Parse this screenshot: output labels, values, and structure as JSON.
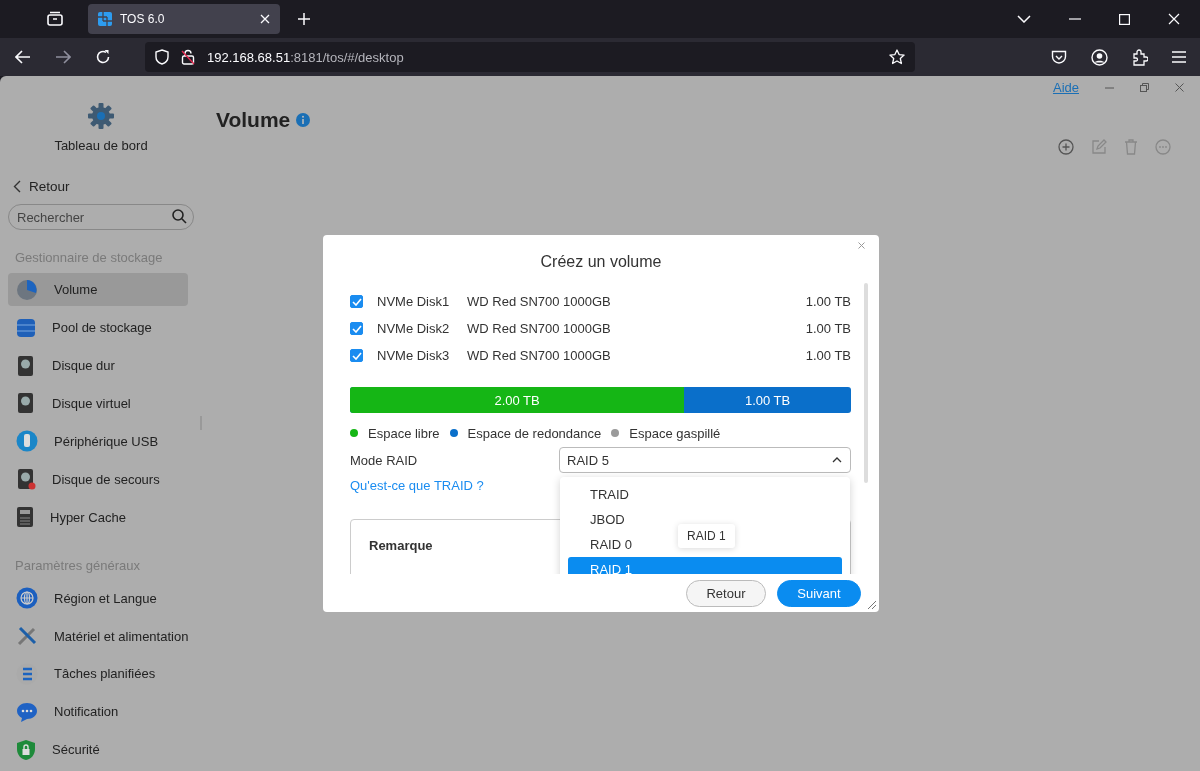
{
  "browser": {
    "tab_title": "TOS 6.0",
    "url_host": "192.168.68.51",
    "url_rest": ":8181/tos/#/desktop"
  },
  "app": {
    "help_link": "Aide",
    "title": "Volume"
  },
  "sidebar": {
    "header": "Tableau de bord",
    "back": "Retour",
    "search_placeholder": "Rechercher",
    "sections": [
      {
        "heading": "Gestionnaire de stockage",
        "items": [
          {
            "label": "Volume",
            "selected": true
          },
          {
            "label": "Pool de stockage",
            "selected": false
          },
          {
            "label": "Disque dur",
            "selected": false
          },
          {
            "label": "Disque virtuel",
            "selected": false
          },
          {
            "label": "Périphérique USB",
            "selected": false
          },
          {
            "label": "Disque de secours",
            "selected": false
          },
          {
            "label": "Hyper Cache",
            "selected": false
          }
        ]
      },
      {
        "heading": "Paramètres généraux",
        "items": [
          {
            "label": "Région et Langue",
            "selected": false
          },
          {
            "label": "Matériel et alimentation",
            "selected": false
          },
          {
            "label": "Tâches planifiées",
            "selected": false
          },
          {
            "label": "Notification",
            "selected": false
          },
          {
            "label": "Sécurité",
            "selected": false
          }
        ]
      }
    ]
  },
  "dialog": {
    "title": "Créez un volume",
    "disks": [
      {
        "name": "NVMe Disk1",
        "model": "WD Red SN700 1000GB",
        "size": "1.00 TB",
        "checked": true
      },
      {
        "name": "NVMe Disk2",
        "model": "WD Red SN700 1000GB",
        "size": "1.00 TB",
        "checked": true
      },
      {
        "name": "NVMe Disk3",
        "model": "WD Red SN700 1000GB",
        "size": "1.00 TB",
        "checked": true
      }
    ],
    "capacity_bar": {
      "level": 0.667,
      "free_label": "2.00 TB",
      "redundancy_label": "1.00 TB"
    },
    "legend": [
      {
        "label": "Espace libre",
        "color": "#15b615"
      },
      {
        "label": "Espace de redondance",
        "color": "#0a6fca"
      },
      {
        "label": "Espace gaspillé",
        "color": "#9a9a9a"
      }
    ],
    "raid_label": "Mode RAID",
    "raid_value": "RAID 5",
    "raid_expanded": true,
    "options": [
      {
        "label": "TRAID",
        "selected": false
      },
      {
        "label": "JBOD",
        "selected": false
      },
      {
        "label": "RAID 0",
        "selected": false
      },
      {
        "label": "RAID 1",
        "selected": true
      }
    ],
    "tooltip": "RAID 1",
    "help_link": "Qu'est-ce que TRAID ?",
    "note_title": "Remarque",
    "buttons": [
      {
        "label": "Retour",
        "kind": "secondary"
      },
      {
        "label": "Suivant",
        "kind": "primary"
      }
    ]
  }
}
